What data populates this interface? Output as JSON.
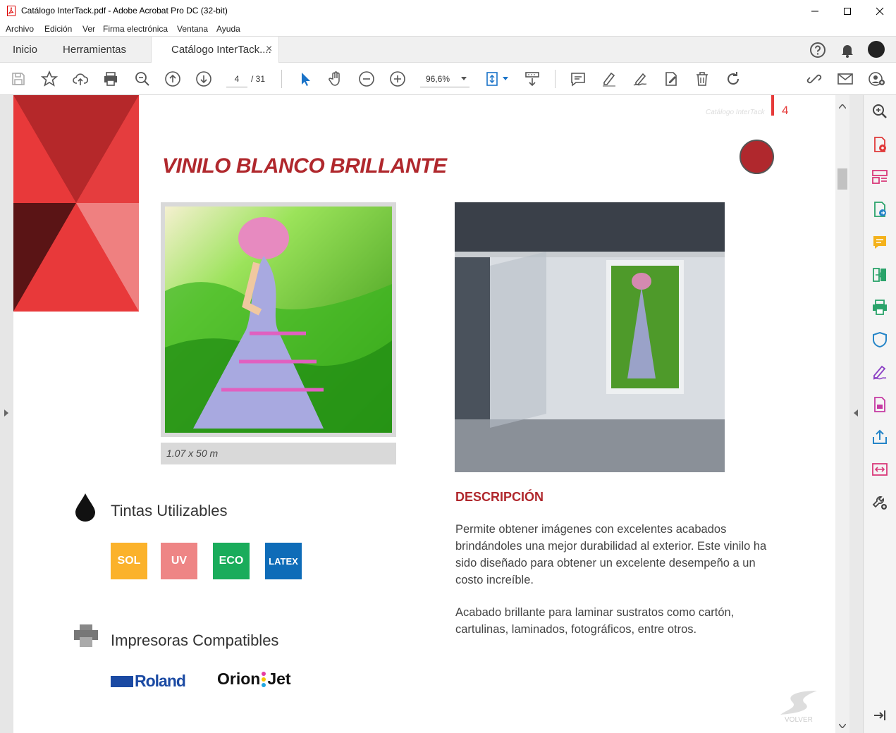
{
  "window": {
    "title": "Catálogo InterTack.pdf - Adobe Acrobat Pro DC (32-bit)",
    "controls": [
      "minimize",
      "maximize",
      "close"
    ]
  },
  "menu": [
    "Archivo",
    "Edición",
    "Ver",
    "Firma electrónica",
    "Ventana",
    "Ayuda"
  ],
  "tabs": {
    "home": "Inicio",
    "tools": "Herramientas",
    "document": "Catálogo InterTack....",
    "close_glyph": "×"
  },
  "toolbar": {
    "current_page": "4",
    "total_pages": "/ 31",
    "zoom": "96,6%"
  },
  "page": {
    "header_brand": "Catálogo InterTack",
    "page_number": "4",
    "title": "VINILO BLANCO BRILLANTE",
    "image_caption": "1.07 x 50 m",
    "inks_title": "Tintas Utilizables",
    "inks": [
      {
        "label": "SOL",
        "color": "#fbb22b"
      },
      {
        "label": "UV",
        "color": "#ee8585"
      },
      {
        "label": "ECO",
        "color": "#1aac5b"
      },
      {
        "label": "LATEX",
        "color": "#0e6cb8"
      }
    ],
    "printers_title": "Impresoras Compatibles",
    "printer_brands": [
      "Roland",
      "Orion",
      "Jet"
    ],
    "description_title": "DESCRIPCIÓN",
    "description_p1": "Permite obtener imágenes con excelentes acabados brindándoles una mejor durabilidad al exterior. Este vinilo ha sido diseñado para obtener un excelente desempeño a un costo increíble.",
    "description_p2": "Acabado brillante para laminar sustratos como cartón, cartulinas, laminados, fotográficos, entre otros.",
    "footer_brand": "VOLVER",
    "accent_color": "#b0282d"
  },
  "right_panel_icons": [
    "zoom-search-icon",
    "create-pdf-icon",
    "organize-pages-icon",
    "export-pdf-icon",
    "comment-icon",
    "combine-files-icon",
    "print-production-icon",
    "protect-icon",
    "fill-sign-icon",
    "edit-pdf-icon",
    "send-icon",
    "compare-icon",
    "more-tools-icon",
    "collapse-panel-icon"
  ]
}
